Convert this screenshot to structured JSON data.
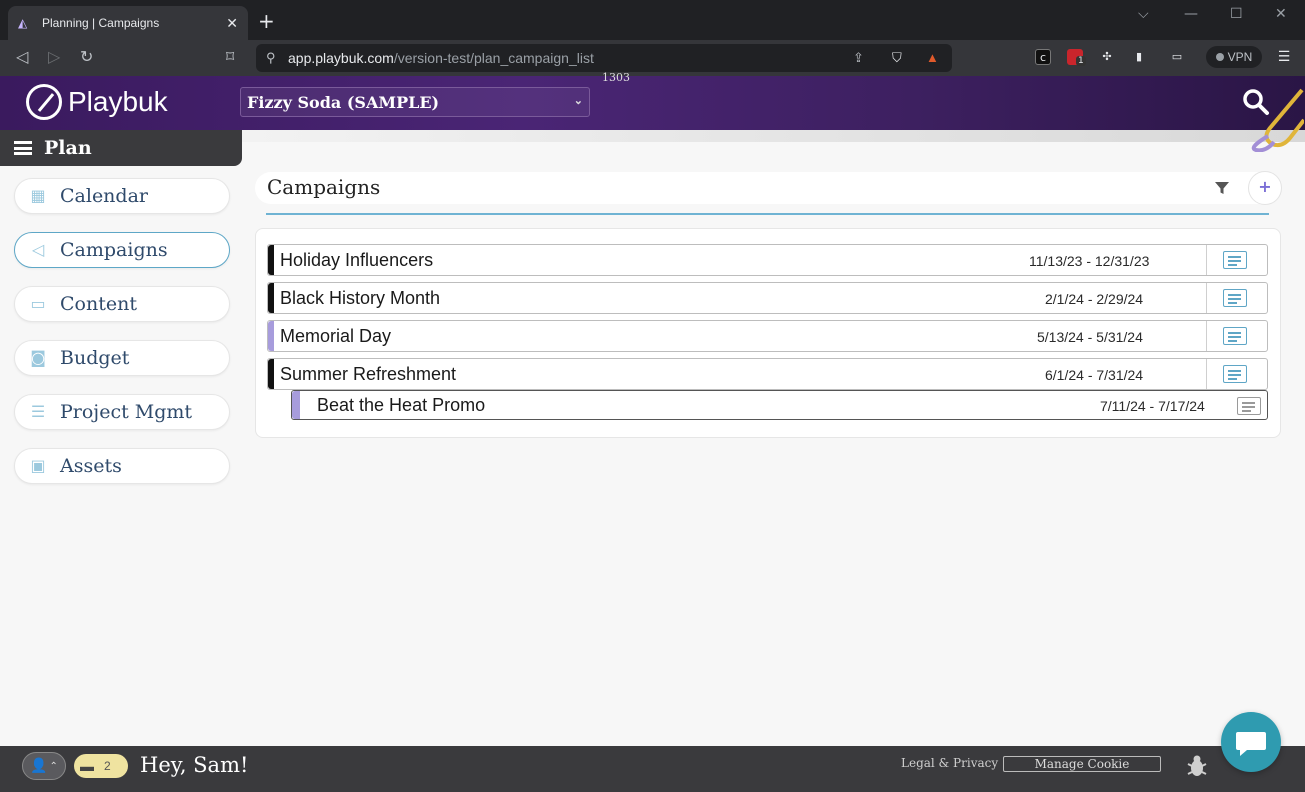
{
  "browser": {
    "tab_title": "Planning | Campaigns",
    "url_host": "app.playbuk.com",
    "url_path": "/version-test/plan_campaign_list",
    "vpn_label": "VPN",
    "extension_badge": "1"
  },
  "header": {
    "logo_text": "Playbuk",
    "brand_selected": "Fizzy Soda (SAMPLE)",
    "tiny_label": "1303"
  },
  "sidebar": {
    "section_title": "Plan",
    "items": [
      {
        "label": "Calendar",
        "icon": "calendar-icon"
      },
      {
        "label": "Campaigns",
        "icon": "megaphone-icon",
        "active": true
      },
      {
        "label": "Content",
        "icon": "layers-icon"
      },
      {
        "label": "Budget",
        "icon": "budget-icon"
      },
      {
        "label": "Project Mgmt",
        "icon": "gantt-icon"
      },
      {
        "label": "Assets",
        "icon": "image-icon"
      }
    ]
  },
  "main": {
    "title": "Campaigns",
    "campaigns": [
      {
        "name": "Holiday Influencers",
        "dates": "11/13/23 - 12/31/23",
        "color": "#111111"
      },
      {
        "name": "Black History Month",
        "dates": "2/1/24 - 2/29/24",
        "color": "#111111"
      },
      {
        "name": "Memorial Day",
        "dates": "5/13/24 - 5/31/24",
        "color": "#a79cdc"
      },
      {
        "name": "Summer Refreshment",
        "dates": "6/1/24 - 7/31/24",
        "color": "#111111"
      },
      {
        "name": "Beat the Heat Promo",
        "dates": "7/11/24 - 7/17/24",
        "color": "#a79cdc",
        "child": true
      }
    ]
  },
  "footer": {
    "inbox_count": "2",
    "greeting": "Hey, Sam!",
    "legal_link": "Legal & Privacy",
    "cookie_button": "Manage Cookie"
  },
  "colors": {
    "accent": "#5fa6c6",
    "header_purple": "#4a2575",
    "chat": "#2f9bb0"
  }
}
